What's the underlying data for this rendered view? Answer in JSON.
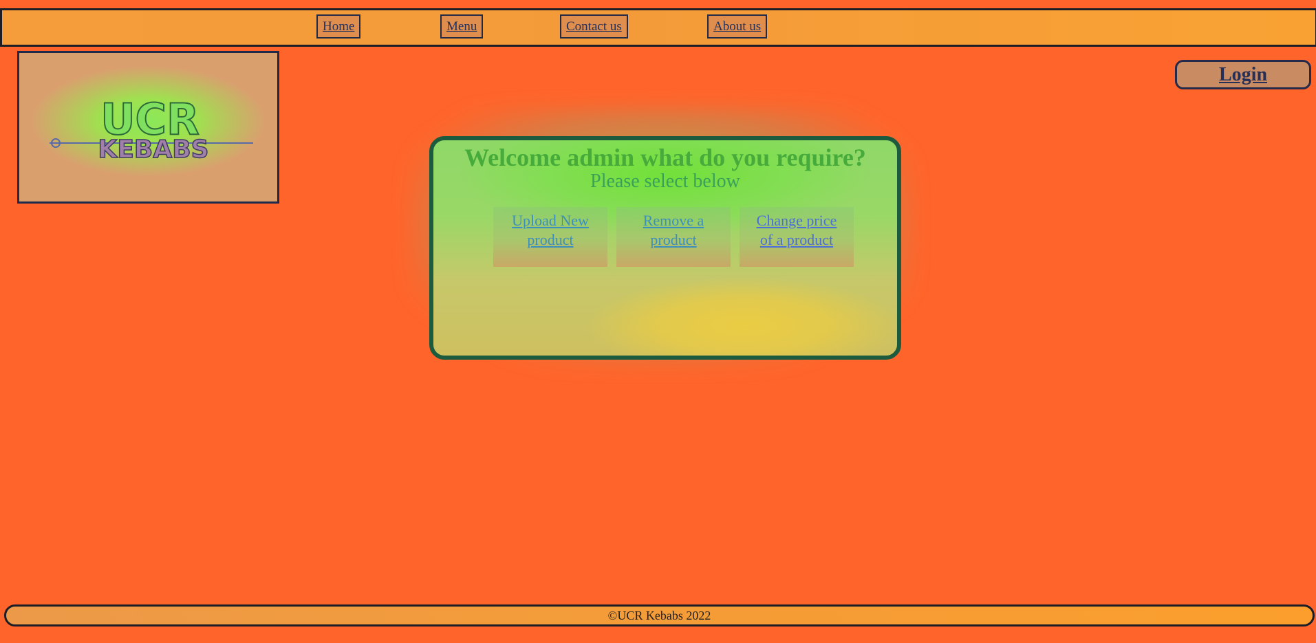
{
  "nav": {
    "home": "Home",
    "menu": "Menu",
    "contact": "Contact us",
    "about": "About us"
  },
  "logo": {
    "line1": "UCR",
    "line2": "KEBABS"
  },
  "login": {
    "label": "Login"
  },
  "admin": {
    "title": "Welcome admin what do you require?",
    "subtitle": "Please select below",
    "actions": [
      {
        "line1": "Upload New",
        "line2": "product"
      },
      {
        "line1": "Remove a",
        "line2": "product"
      },
      {
        "line1": "Change price",
        "line2": "of a product"
      }
    ]
  },
  "footer": {
    "text": "©UCR Kebabs 2022"
  },
  "colors": {
    "page_background": "#ff652b",
    "nav_background": "#f59d3b",
    "panel_border": "#1c5b3e",
    "title_text": "#47ab3b",
    "link_text": "#3b8fbf"
  }
}
